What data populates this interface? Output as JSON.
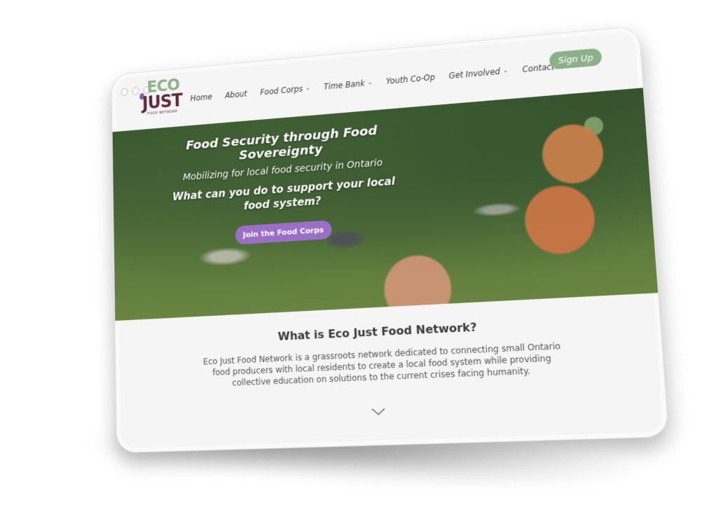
{
  "logo": {
    "line1": "ECO",
    "line2": "JUST",
    "tagline": "FOOD NETWORK"
  },
  "nav": {
    "items": [
      {
        "label": "Home",
        "has_dropdown": false
      },
      {
        "label": "About",
        "has_dropdown": false
      },
      {
        "label": "Food Corps",
        "has_dropdown": true
      },
      {
        "label": "Time Bank",
        "has_dropdown": true
      },
      {
        "label": "Youth Co-Op",
        "has_dropdown": false
      },
      {
        "label": "Get Involved",
        "has_dropdown": true
      },
      {
        "label": "Contact",
        "has_dropdown": false
      }
    ],
    "signup_label": "Sign Up"
  },
  "hero": {
    "title": "Food Security through Food Sovereignty",
    "subtitle": "Mobilizing for local food security in Ontario",
    "question": "What can you do to support your local food system?",
    "cta_label": "Join the Food Corps"
  },
  "about": {
    "title": "What is Eco Just Food Network?",
    "text": "Eco Just Food Network is a grassroots network dedicated to connecting small Ontario food producers with local residents to create a local food system while providing collective education on solutions to the current crises facing humanity."
  },
  "colors": {
    "brand_green": "#8bb08a",
    "brand_plum": "#5b2a3c",
    "cta_purple": "#9b6fc7"
  },
  "icons": {
    "dropdown": "chevron-down-icon",
    "scroll": "chevron-down-icon"
  }
}
